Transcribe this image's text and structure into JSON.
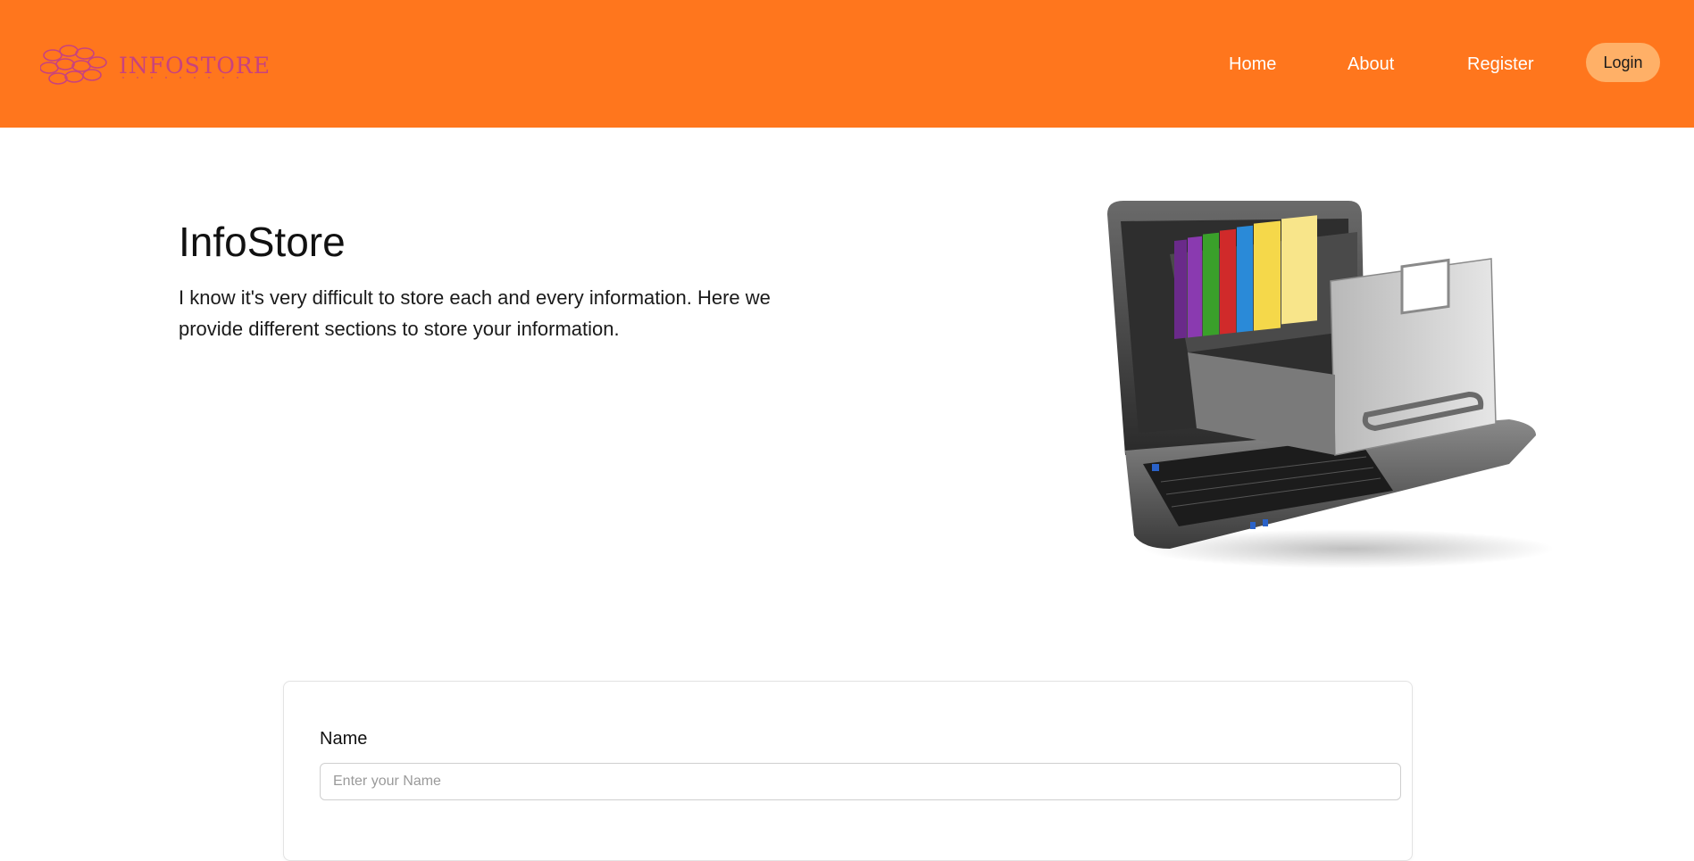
{
  "navbar": {
    "brand": "INFOSTORE",
    "links": [
      {
        "label": "Home"
      },
      {
        "label": "About"
      },
      {
        "label": "Register"
      }
    ],
    "login_label": "Login",
    "color": "#ff761d",
    "login_color": "#ffb067"
  },
  "hero": {
    "title": "InfoStore",
    "description": "I know it's very difficult to store each and every information. Here we provide different sections to store your information.",
    "image_icon": "laptop-file-drawer-illustration"
  },
  "form": {
    "name_label": "Name",
    "name_placeholder": "Enter your Name"
  }
}
